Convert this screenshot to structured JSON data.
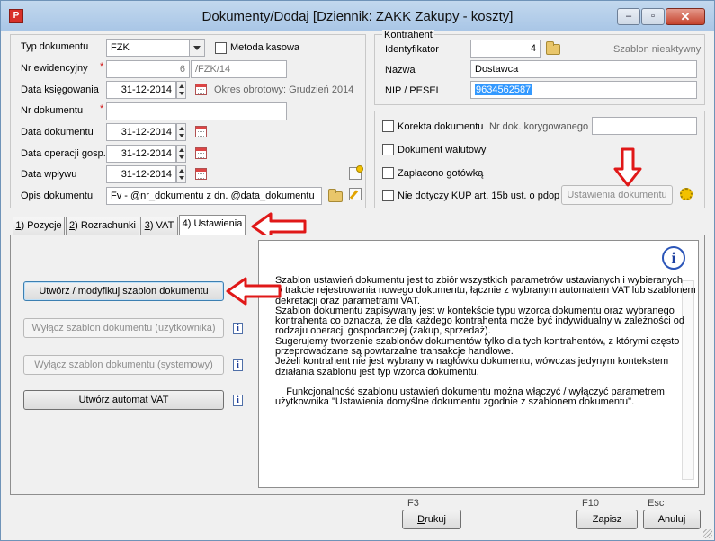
{
  "window": {
    "title": "Dokumenty/Dodaj [Dziennik: ZAKK  Zakupy - koszty]",
    "minimize": "‒",
    "maximize": "▫",
    "close": "✕",
    "app_icon": "P"
  },
  "left_form": {
    "typ_dokumentu": {
      "label": "Typ dokumentu",
      "value": "FZK"
    },
    "metoda_kasowa": {
      "label": "Metoda kasowa",
      "checked": false
    },
    "nr_ewidencyjny": {
      "label": "Nr ewidencyjny",
      "required": "*",
      "number": "6",
      "suffix": "/FZK/14"
    },
    "data_ksiegowania": {
      "label": "Data księgowania",
      "value": "31-12-2014",
      "okres": "Okres obrotowy: Grudzień 2014"
    },
    "nr_dokumentu": {
      "label": "Nr dokumentu",
      "required": "*",
      "value": ""
    },
    "data_dokumentu": {
      "label": "Data dokumentu",
      "value": "31-12-2014"
    },
    "data_operacji": {
      "label": "Data operacji gosp.",
      "value": "31-12-2014"
    },
    "data_wplywu": {
      "label": "Data wpływu",
      "value": "31-12-2014"
    },
    "opis_dokumentu": {
      "label": "Opis dokumentu",
      "value": "Fv - @nr_dokumentu z dn. @data_dokumentu"
    }
  },
  "kontrahent": {
    "group_label": "Kontrahent",
    "identyfikator": {
      "label": "Identyfikator",
      "value": "4"
    },
    "szablon": "Szablon nieaktywny",
    "nazwa": {
      "label": "Nazwa",
      "value": "Dostawca"
    },
    "nip": {
      "label": "NIP / PESEL",
      "value": "9634562587"
    }
  },
  "options": {
    "korekta": {
      "label": "Korekta dokumentu",
      "checked": false
    },
    "nr_korygowanego": {
      "label": "Nr dok. korygowanego",
      "value": ""
    },
    "walutowy": {
      "label": "Dokument walutowy",
      "checked": false
    },
    "gotowka": {
      "label": "Zapłacono gotówką",
      "checked": false
    },
    "kup": {
      "label": "Nie dotyczy KUP art. 15b ust. o pdop",
      "checked": false
    },
    "ustawienia_button": "Ustawienia dokumentu"
  },
  "tabs": [
    {
      "hot": "1",
      "rest": ") Pozycje"
    },
    {
      "hot": "2",
      "rest": ") Rozrachunki"
    },
    {
      "hot": "3",
      "rest": ") VAT"
    },
    {
      "hot": "",
      "rest": "4) Ustawienia"
    }
  ],
  "settings_buttons": {
    "utworz_szablon": "Utwórz / modyfikuj szablon dokumentu",
    "wylacz_uzytkownika": "Wyłącz szablon dokumentu (użytkownika)",
    "wylacz_systemowy": "Wyłącz szablon dokumentu (systemowy)",
    "utworz_automat": "Utwórz automat VAT",
    "info_glyph": "i"
  },
  "info_text": {
    "lines": [
      "Szablon ustawień dokumentu jest to zbiór wszystkich parametrów ustawianych i wybieranych",
      "w trakcie rejestrowania nowego dokumentu, łącznie z wybranym automatem VAT lub szablonem",
      "dekretacji oraz parametrami VAT.",
      "Szablon dokumentu zapisywany jest w kontekście typu wzorca dokumentu oraz wybranego",
      "kontrahenta co oznacza, że dla każdego kontrahenta może być indywidualny w zależności od",
      "rodzaju operacji gospodarczej (zakup, sprzedaż).",
      "Sugerujemy tworzenie szablonów dokumentów tylko dla tych kontrahentów, z którymi często",
      "przeprowadzane są powtarzalne transakcje handlowe.",
      "Jeżeli kontrahent nie jest wybrany w nagłówku dokumentu, wówczas jedynym kontekstem",
      "działania szablonu jest typ wzorca dokumentu.",
      "",
      "    Funkcjonalność szablonu ustawień dokumentu można włączyć / wyłączyć parametrem",
      "użytkownika \"Ustawienia domyślne dokumentu zgodnie z szablonem dokumentu\"."
    ],
    "big_info_glyph": "i"
  },
  "footer": {
    "f3": "F3",
    "drukuj": {
      "hot": "D",
      "rest": "rukuj"
    },
    "f10": "F10",
    "esc": "Esc",
    "zapisz": "Zapisz",
    "anuluj": "Anuluj"
  },
  "colors": {
    "annotation_red": "#e01818",
    "selection": "#3399ff",
    "gear": "#f2c100"
  }
}
